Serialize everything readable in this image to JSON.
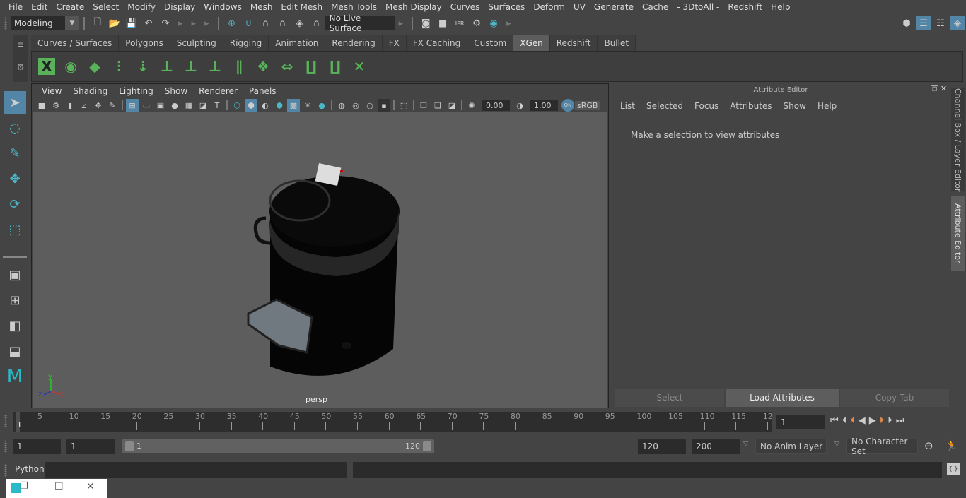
{
  "menubar": [
    "File",
    "Edit",
    "Create",
    "Select",
    "Modify",
    "Display",
    "Windows",
    "Mesh",
    "Edit Mesh",
    "Mesh Tools",
    "Mesh Display",
    "Curves",
    "Surfaces",
    "Deform",
    "UV",
    "Generate",
    "Cache",
    "- 3DtoAll -",
    "Redshift",
    "Help"
  ],
  "statusline": {
    "mode": "Modeling",
    "live_surface": "No Live Surface"
  },
  "shelf_tabs": [
    "Curves / Surfaces",
    "Polygons",
    "Sculpting",
    "Rigging",
    "Animation",
    "Rendering",
    "FX",
    "FX Caching",
    "Custom",
    "XGen",
    "Redshift",
    "Bullet"
  ],
  "active_shelf_tab": "XGen",
  "shelf_icons": [
    "xgen-editor-icon",
    "toggle-visibility-icon",
    "create-description-icon",
    "add-guides-icon",
    "place-guides-icon",
    "add-guide-icon",
    "sculpt-guide-icon",
    "lock-guide-icon",
    "guide-curves-icon",
    "groom-icon",
    "flip-guides-icon",
    "select-guides-icon",
    "convert-guides-icon",
    "delete-guides-icon"
  ],
  "viewport": {
    "menu": [
      "View",
      "Shading",
      "Lighting",
      "Show",
      "Renderer",
      "Panels"
    ],
    "exposure": "0.00",
    "gamma": "1.00",
    "colorspace": "sRGB",
    "camera_label": "persp",
    "axis": {
      "x": "x",
      "y": "y",
      "z": "z"
    }
  },
  "attribute_editor": {
    "title": "Attribute Editor",
    "menu": [
      "List",
      "Selected",
      "Focus",
      "Attributes",
      "Show",
      "Help"
    ],
    "message": "Make a selection to view attributes",
    "buttons": {
      "select": "Select",
      "load": "Load Attributes",
      "copy": "Copy Tab"
    }
  },
  "side_tabs": {
    "channel_box": "Channel Box / Layer Editor",
    "attribute_editor": "Attribute Editor"
  },
  "timeline": {
    "ticks": [
      "5",
      "10",
      "15",
      "20",
      "25",
      "30",
      "35",
      "40",
      "45",
      "50",
      "55",
      "60",
      "65",
      "70",
      "75",
      "80",
      "85",
      "90",
      "95",
      "100",
      "105",
      "110",
      "115",
      "12"
    ],
    "current_label": "1",
    "current_frame": "1"
  },
  "range": {
    "start": "1",
    "playback_start": "1",
    "slider_start": "1",
    "slider_end": "120",
    "playback_end": "120",
    "end": "200",
    "anim_layer": "No Anim Layer",
    "character_set": "No Character Set"
  },
  "command_line": {
    "lang": "Python"
  }
}
